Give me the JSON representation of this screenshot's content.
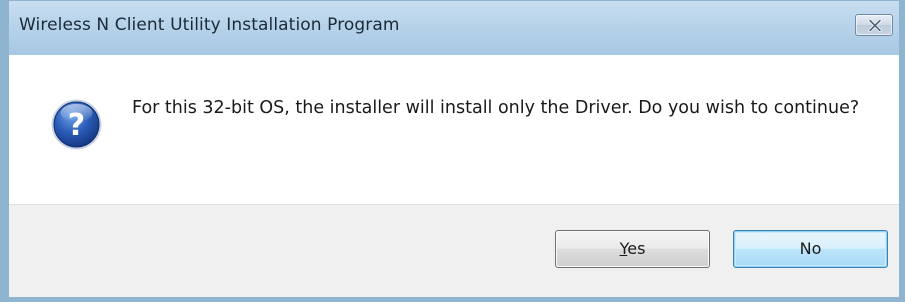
{
  "window": {
    "title": "Wireless N Client Utility Installation Program"
  },
  "dialog": {
    "icon": "question-icon",
    "message": "For this 32-bit OS, the installer will install only the Driver. Do you wish to continue?"
  },
  "buttons": {
    "yes": {
      "mnemonic": "Y",
      "rest": "es"
    },
    "no": {
      "label": "No"
    }
  },
  "colors": {
    "titlebar": "#b7d3ea",
    "button_area": "#f0f0f0",
    "icon_blue": "#1f4fa8",
    "default_button_border": "#3c7fb1"
  }
}
